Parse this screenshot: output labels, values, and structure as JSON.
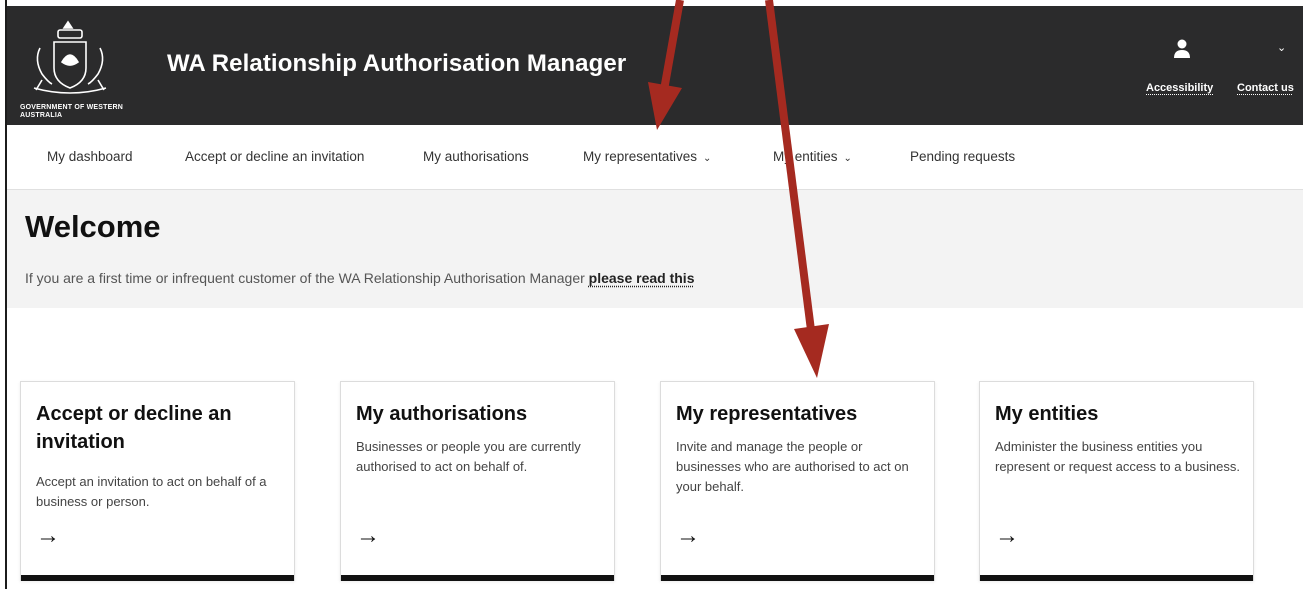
{
  "header": {
    "crest_text": "GOVERNMENT OF WESTERN AUSTRALIA",
    "title": "WA Relationship Authorisation Manager",
    "links": [
      "Accessibility",
      "Contact us"
    ]
  },
  "nav": {
    "items": [
      {
        "label": "My dashboard"
      },
      {
        "label": "Accept or decline an invitation"
      },
      {
        "label": "My authorisations"
      },
      {
        "label": "My representatives",
        "dropdown": true
      },
      {
        "label": "My entities",
        "dropdown": true
      },
      {
        "label": "Pending requests"
      }
    ]
  },
  "welcome": {
    "heading": "Welcome",
    "intro": "If you are a first time or infrequent customer of the WA Relationship Authorisation Manager",
    "link": "please read this"
  },
  "cards": [
    {
      "title": "Accept or decline an invitation",
      "text": "Accept an invitation to act on behalf of a business or person.",
      "arrow": "→"
    },
    {
      "title": "My authorisations",
      "text": "Businesses or people you are currently authorised to act on behalf of.",
      "arrow": "→"
    },
    {
      "title": "My representatives",
      "text": "Invite and manage the people or businesses who are authorised to act on your behalf.",
      "arrow": "→"
    },
    {
      "title": "My entities",
      "text": "Administer the business entities you represent or request access to a business.",
      "arrow": "→"
    }
  ],
  "colors": {
    "header_bg": "#2b2b2c",
    "welcome_bg": "#f3f3f3",
    "annotation_arrow": "#a52a20"
  }
}
